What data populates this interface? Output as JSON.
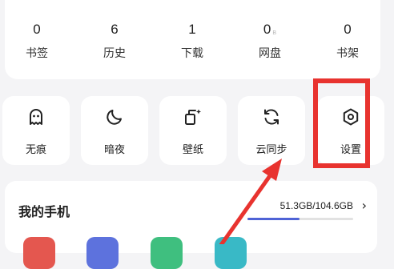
{
  "stats": [
    {
      "value": "0",
      "label": "书签"
    },
    {
      "value": "6",
      "label": "历史"
    },
    {
      "value": "1",
      "label": "下载"
    },
    {
      "value": "0",
      "unit": "B",
      "label": "网盘"
    },
    {
      "value": "0",
      "label": "书架"
    }
  ],
  "tools": [
    {
      "label": "无痕",
      "icon": "ghost-icon"
    },
    {
      "label": "暗夜",
      "icon": "moon-icon"
    },
    {
      "label": "壁纸",
      "icon": "wallpaper-icon"
    },
    {
      "label": "云同步",
      "icon": "sync-icon"
    },
    {
      "label": "设置",
      "icon": "settings-icon"
    }
  ],
  "phone": {
    "title": "我的手机",
    "storage": "51.3GB/104.6GB",
    "chevron": "›",
    "usage_fraction": 0.49
  },
  "colors": {
    "highlight": "#e8332f",
    "accent": "#4f63d6",
    "background": "#f4f4f6"
  }
}
